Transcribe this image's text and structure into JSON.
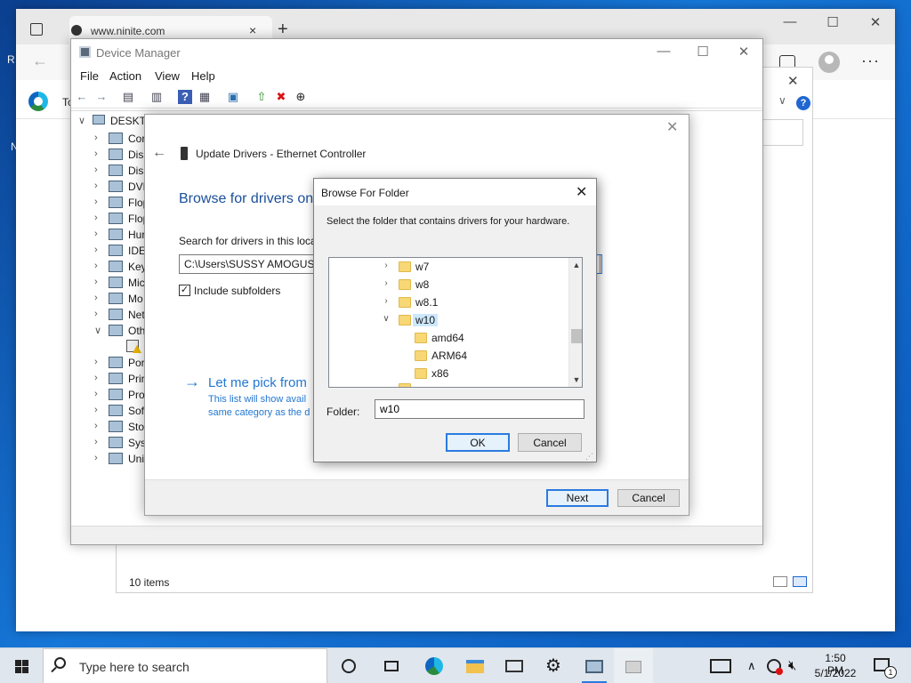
{
  "desktop": {
    "left_letters": [
      "R",
      "N"
    ]
  },
  "browser": {
    "tab_title": "www.ninite.com",
    "tab_close": "×",
    "new_tab": "+",
    "back": "←",
    "fav_partial": "To",
    "min": "—",
    "max": "☐",
    "close": "✕",
    "more": "···"
  },
  "explorer": {
    "status": "10 items",
    "close": "✕",
    "help": "?",
    "chevron": "∨"
  },
  "device_manager": {
    "title": "Device Manager",
    "min": "—",
    "max": "☐",
    "close": "✕",
    "menus": [
      "File",
      "Action",
      "View",
      "Help"
    ],
    "toolbar": [
      "←",
      "→",
      "▤",
      "▥",
      "?",
      "▦",
      "▣",
      "⇧",
      "✖",
      "⊕"
    ],
    "tree_root": "DESKTO",
    "tree_items": [
      {
        "chev": "›",
        "label": "Cor"
      },
      {
        "chev": "›",
        "label": "Disk"
      },
      {
        "chev": "›",
        "label": "Disp"
      },
      {
        "chev": "›",
        "label": "DVD"
      },
      {
        "chev": "›",
        "label": "Flop"
      },
      {
        "chev": "›",
        "label": "Flop"
      },
      {
        "chev": "›",
        "label": "Hur"
      },
      {
        "chev": "›",
        "label": "IDE"
      },
      {
        "chev": "›",
        "label": "Key"
      },
      {
        "chev": "›",
        "label": "Mic"
      },
      {
        "chev": "›",
        "label": "Mo"
      },
      {
        "chev": "›",
        "label": "Net"
      },
      {
        "chev": "∨",
        "label": "Oth"
      },
      {
        "chev": "",
        "label": ""
      },
      {
        "chev": "›",
        "label": "Por"
      },
      {
        "chev": "›",
        "label": "Prir"
      },
      {
        "chev": "›",
        "label": "Pro"
      },
      {
        "chev": "›",
        "label": "Soft"
      },
      {
        "chev": "›",
        "label": "Stor"
      },
      {
        "chev": "›",
        "label": "Syst"
      },
      {
        "chev": "›",
        "label": "Uni"
      }
    ]
  },
  "update_drivers": {
    "close": "✕",
    "back": "←",
    "title": "Update Drivers - Ethernet Controller",
    "heading": "Browse for drivers on",
    "search_label": "Search for drivers in this locat",
    "path_value": "C:\\Users\\SUSSY AMOGUS H",
    "include_subfolders": "Include subfolders",
    "checked_mark": "✓",
    "pick_arrow": "→",
    "pick_link": "Let me pick from",
    "pick_desc1": "This list will show avail",
    "pick_desc2": "same category as the d",
    "next": "Next",
    "cancel": "Cancel"
  },
  "browse_folder": {
    "title": "Browse For Folder",
    "close": "✕",
    "prompt": "Select the folder that contains drivers for your hardware.",
    "scroll_up": "▲",
    "scroll_down": "▼",
    "tree": [
      {
        "chev": "›",
        "label": "w7",
        "level": 0,
        "selected": false
      },
      {
        "chev": "›",
        "label": "w8",
        "level": 0,
        "selected": false
      },
      {
        "chev": "›",
        "label": "w8.1",
        "level": 0,
        "selected": false
      },
      {
        "chev": "∨",
        "label": "w10",
        "level": 0,
        "selected": true
      },
      {
        "chev": "",
        "label": "amd64",
        "level": 1,
        "selected": false
      },
      {
        "chev": "",
        "label": "ARM64",
        "level": 1,
        "selected": false
      },
      {
        "chev": "",
        "label": "x86",
        "level": 1,
        "selected": false
      }
    ],
    "folder_label": "Folder:",
    "folder_value": "w10",
    "ok": "OK",
    "cancel": "Cancel"
  },
  "taskbar": {
    "search_placeholder": "Type here to search",
    "time": "1:50 PM",
    "date": "5/1/2022",
    "notification_count": "1",
    "tray_chevron": "∧"
  },
  "colors": {
    "accent": "#2377d1",
    "heading": "#1a4f9c",
    "selection": "#cce8ff",
    "folder": "#f8d775"
  }
}
